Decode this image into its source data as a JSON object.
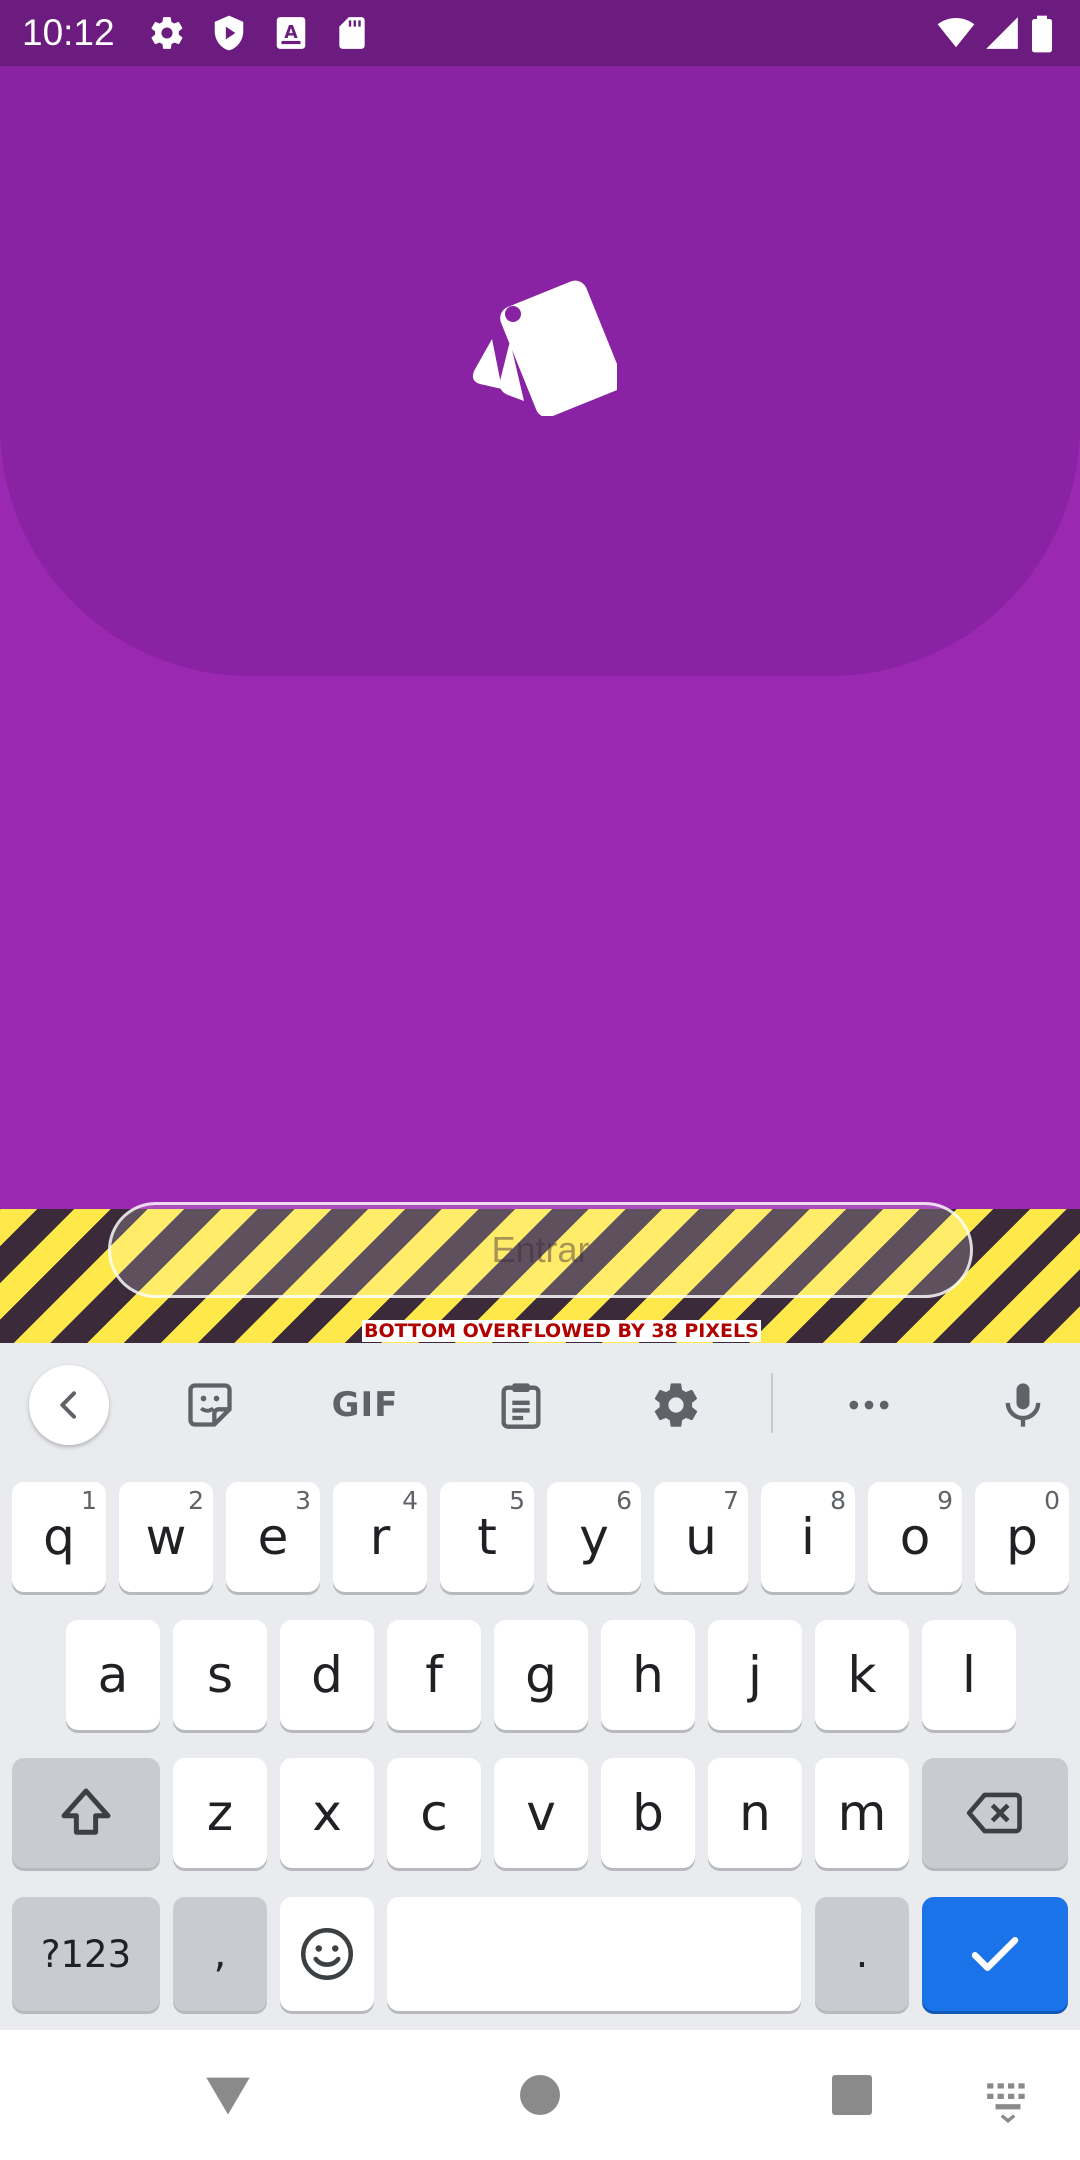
{
  "status_bar": {
    "time": "10:12",
    "icons": [
      "settings-icon",
      "shield-play-icon",
      "keyboard-a-icon",
      "sd-card-icon",
      "wifi-icon",
      "signal-icon",
      "battery-icon"
    ]
  },
  "app": {
    "background_color": "#9a28b0",
    "header_color": "#8923a3",
    "logo": "cards-stack-icon",
    "enter_button_label": "Entrar",
    "overflow_message": "BOTTOM OVERFLOWED BY 38 PIXELS"
  },
  "keyboard": {
    "toolbar": {
      "items": [
        "back-icon",
        "sticker-icon",
        "gif-button",
        "clipboard-icon",
        "settings-icon",
        "more-icon",
        "microphone-icon"
      ],
      "gif_label": "GIF"
    },
    "row1": [
      {
        "label": "q",
        "hint": "1"
      },
      {
        "label": "w",
        "hint": "2"
      },
      {
        "label": "e",
        "hint": "3"
      },
      {
        "label": "r",
        "hint": "4"
      },
      {
        "label": "t",
        "hint": "5"
      },
      {
        "label": "y",
        "hint": "6"
      },
      {
        "label": "u",
        "hint": "7"
      },
      {
        "label": "i",
        "hint": "8"
      },
      {
        "label": "o",
        "hint": "9"
      },
      {
        "label": "p",
        "hint": "0"
      }
    ],
    "row2": [
      "a",
      "s",
      "d",
      "f",
      "g",
      "h",
      "j",
      "k",
      "l"
    ],
    "row3": [
      "z",
      "x",
      "c",
      "v",
      "b",
      "n",
      "m"
    ],
    "symbols_label": "?123",
    "comma_label": ",",
    "period_label": ".",
    "enter_color": "#1a73e8"
  },
  "nav_bar": {
    "buttons": [
      "back-triangle-icon",
      "home-circle-icon",
      "recents-square-icon",
      "keyboard-switch-icon"
    ]
  }
}
